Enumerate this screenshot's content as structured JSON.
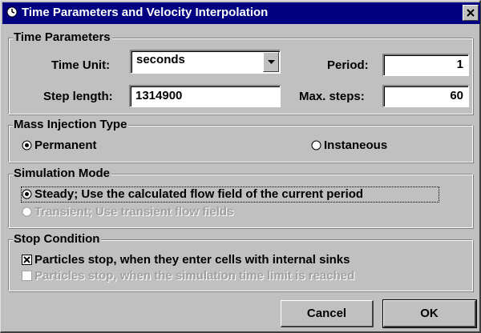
{
  "window": {
    "title": "Time Parameters and Velocity Interpolation",
    "title_bar_color": "#000080"
  },
  "time_parameters": {
    "group_title": "Time Parameters",
    "time_unit_label": "Time Unit:",
    "time_unit_value": "seconds",
    "step_length_label": "Step length:",
    "step_length_value": "1314900",
    "period_label": "Period:",
    "period_value": "1",
    "max_steps_label": "Max. steps:",
    "max_steps_value": "60"
  },
  "mass_injection": {
    "group_title": "Mass Injection Type",
    "options": [
      {
        "label": "Permanent",
        "selected": true,
        "enabled": true
      },
      {
        "label": "Instaneous",
        "selected": false,
        "enabled": true
      }
    ]
  },
  "simulation_mode": {
    "group_title": "Simulation Mode",
    "options": [
      {
        "label": "Steady; Use the calculated flow field of the current period",
        "selected": true,
        "enabled": true
      },
      {
        "label": "Transient; Use transient flow fields",
        "selected": false,
        "enabled": false
      }
    ]
  },
  "stop_condition": {
    "group_title": "Stop Condition",
    "options": [
      {
        "label": "Particles stop, when they enter cells with internal sinks",
        "checked": true,
        "enabled": true
      },
      {
        "label": "Particles stop, when the simulation time limit is reached",
        "checked": false,
        "enabled": false
      }
    ]
  },
  "buttons": {
    "cancel": "Cancel",
    "ok": "OK"
  }
}
